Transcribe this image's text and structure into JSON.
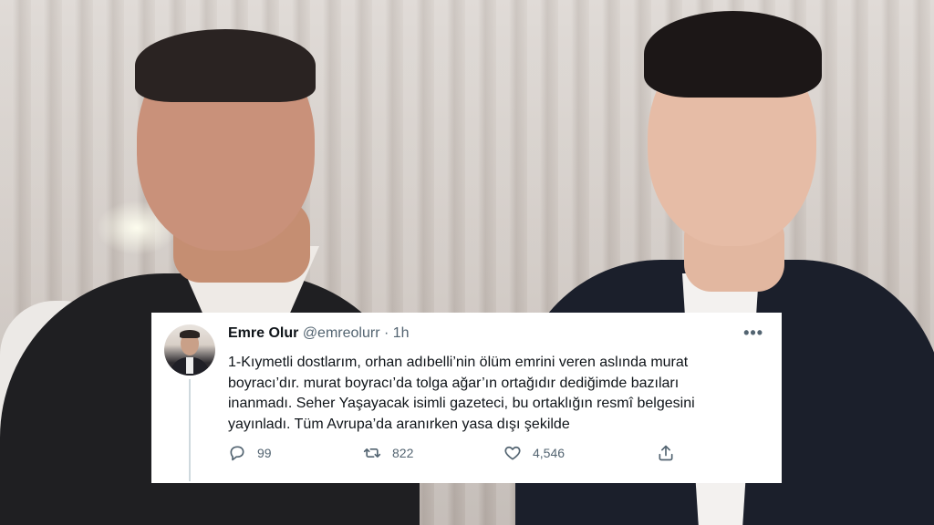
{
  "tweet": {
    "display_name": "Emre Olur",
    "handle": "@emreolurr",
    "separator": "·",
    "time": "1h",
    "more": "•••",
    "text_lines": [
      "1-Kıymetli dostlarım, orhan adıbelli’nin ölüm emrini veren aslında murat",
      "boyracı’dır. murat boyracı’da tolga ağar’ın ortağıdır dediğimde bazıları",
      "inanmadı. Seher Yaşayacak isimli gazeteci, bu ortaklığın resmî belgesini",
      "yayınladı. Tüm Avrupa’da aranırken yasa dışı şekilde"
    ],
    "actions": {
      "replies": "99",
      "retweets": "822",
      "likes": "4,546"
    },
    "icons": [
      "reply-icon",
      "retweet-icon",
      "like-icon",
      "share-icon",
      "more-icon"
    ]
  },
  "colors": {
    "name": "#0f1419",
    "secondary": "#536471",
    "card_bg": "#ffffff"
  }
}
